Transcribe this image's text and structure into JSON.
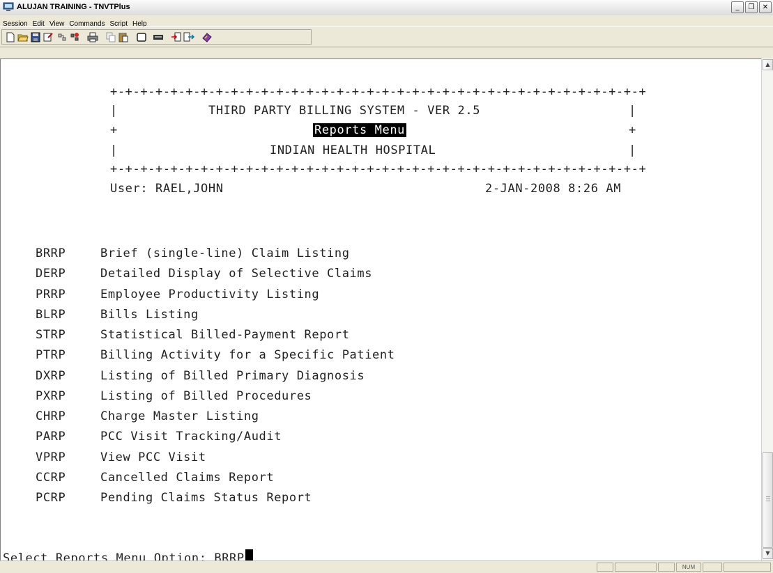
{
  "window": {
    "title": "ALUJAN TRAINING - TNVTPlus",
    "controls": {
      "minimize": "_",
      "restore": "❐",
      "close": "✕"
    }
  },
  "menubar": [
    "Session",
    "Edit",
    "View",
    "Commands",
    "Script",
    "Help"
  ],
  "toolbar": {
    "buttons": [
      "new-icon",
      "open-icon",
      "save-icon",
      "properties-icon",
      "connect-icon",
      "disconnect-icon",
      "print-icon",
      "copy-icon",
      "paste-icon",
      "box-icon",
      "keyboard-icon",
      "import-icon",
      "export-icon",
      "help-book-icon"
    ]
  },
  "terminal": {
    "border_line": "+-+-+-+-+-+-+-+-+-+-+-+-+-+-+-+-+-+-+-+-+-+-+-+-+-+-+-+-+-+-+-+-+-+-+-+",
    "header_edge_vertical": "|",
    "header_edge_plus": "+",
    "system_title": "THIRD PARTY BILLING SYSTEM - VER 2.5",
    "menu_title": "Reports Menu",
    "facility": "INDIAN HEALTH HOSPITAL",
    "user_line": "User: RAEL,JOHN",
    "datetime": "2-JAN-2008 8:26 AM",
    "menu_items": [
      {
        "code": "BRRP",
        "label": "Brief (single-line) Claim Listing"
      },
      {
        "code": "DERP",
        "label": "Detailed Display of Selective Claims"
      },
      {
        "code": "PRRP",
        "label": "Employee Productivity Listing"
      },
      {
        "code": "BLRP",
        "label": "Bills Listing"
      },
      {
        "code": "STRP",
        "label": "Statistical Billed-Payment Report"
      },
      {
        "code": "PTRP",
        "label": "Billing Activity for a Specific Patient"
      },
      {
        "code": "DXRP",
        "label": "Listing of Billed Primary Diagnosis"
      },
      {
        "code": "PXRP",
        "label": "Listing of Billed Procedures"
      },
      {
        "code": "CHRP",
        "label": "Charge Master Listing"
      },
      {
        "code": "PARP",
        "label": "PCC Visit Tracking/Audit"
      },
      {
        "code": "VPRP",
        "label": "View PCC Visit"
      },
      {
        "code": "CCRP",
        "label": "Cancelled Claims Report"
      },
      {
        "code": "PCRP",
        "label": "Pending Claims Status Report"
      }
    ],
    "prompt": "Select Reports Menu Option: ",
    "input_value": "BRRP"
  },
  "scrollbar": {
    "up": "▲",
    "down": "▼"
  },
  "statusbar": {
    "num_indicator": "NUM"
  },
  "colors": {
    "terminal_bg": "#ffffff",
    "highlight_bg": "#000000",
    "chrome": "#ece9d8"
  }
}
